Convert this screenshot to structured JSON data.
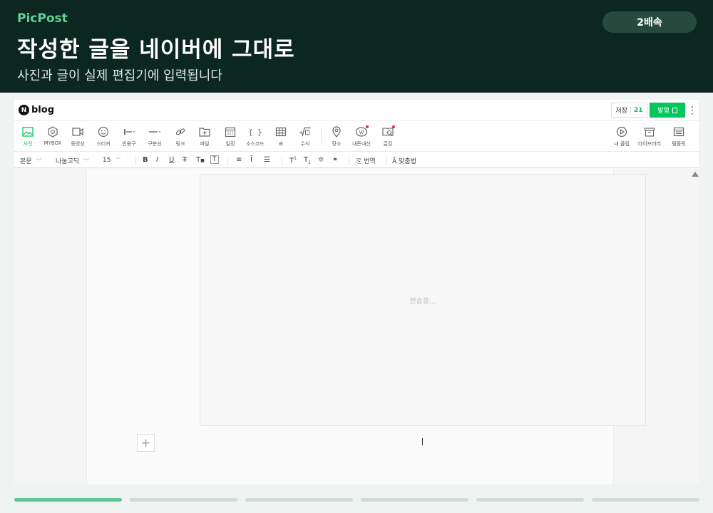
{
  "hero": {
    "brand": "PicPost",
    "title": "작성한 글을 네이버에 그대로",
    "subtitle": "사진과 글이 실제 편집기에 입력됩니다",
    "speed_label": "2배속"
  },
  "editor": {
    "logo_text": "blog",
    "save_label": "저장",
    "save_count": "21",
    "publish_label": "발행",
    "toolbar": [
      {
        "label": "사진",
        "icon": "photo-icon",
        "active": true
      },
      {
        "label": "MYBOX",
        "icon": "mybox-icon"
      },
      {
        "label": "동영상",
        "icon": "video-icon"
      },
      {
        "label": "스티커",
        "icon": "sticker-icon"
      },
      {
        "label": "인용구",
        "icon": "quote-icon"
      },
      {
        "label": "구분선",
        "icon": "divider-line-icon"
      },
      {
        "label": "링크",
        "icon": "link-icon"
      },
      {
        "label": "파일",
        "icon": "file-icon"
      },
      {
        "label": "일정",
        "icon": "calendar-icon"
      },
      {
        "label": "소스코드",
        "icon": "source-code-icon"
      },
      {
        "label": "표",
        "icon": "table-icon"
      },
      {
        "label": "수식",
        "icon": "formula-icon"
      },
      {
        "label": "장소",
        "icon": "location-pin-icon"
      },
      {
        "label": "내돈내산",
        "icon": "my-money-icon"
      },
      {
        "label": "글감",
        "icon": "material-search-icon"
      },
      {
        "label": "내 클립",
        "icon": "clip-play-icon"
      },
      {
        "label": "라이브러리",
        "icon": "library-icon"
      },
      {
        "label": "템플릿",
        "icon": "template-icon"
      }
    ],
    "format": {
      "style": "본문",
      "font": "나눔고딕",
      "size": "15",
      "translate_label": "번역",
      "spell_label": "맞춤법"
    },
    "upload_status": "전송중..."
  },
  "progress": {
    "total_segments": 6,
    "completed_segments": 1
  },
  "colors": {
    "hero_bg": "#0c2620",
    "brand_green": "#5fd39a",
    "naver_green": "#03c75a",
    "progress_done": "#5cc793",
    "progress_todo": "#cfdbd6"
  }
}
